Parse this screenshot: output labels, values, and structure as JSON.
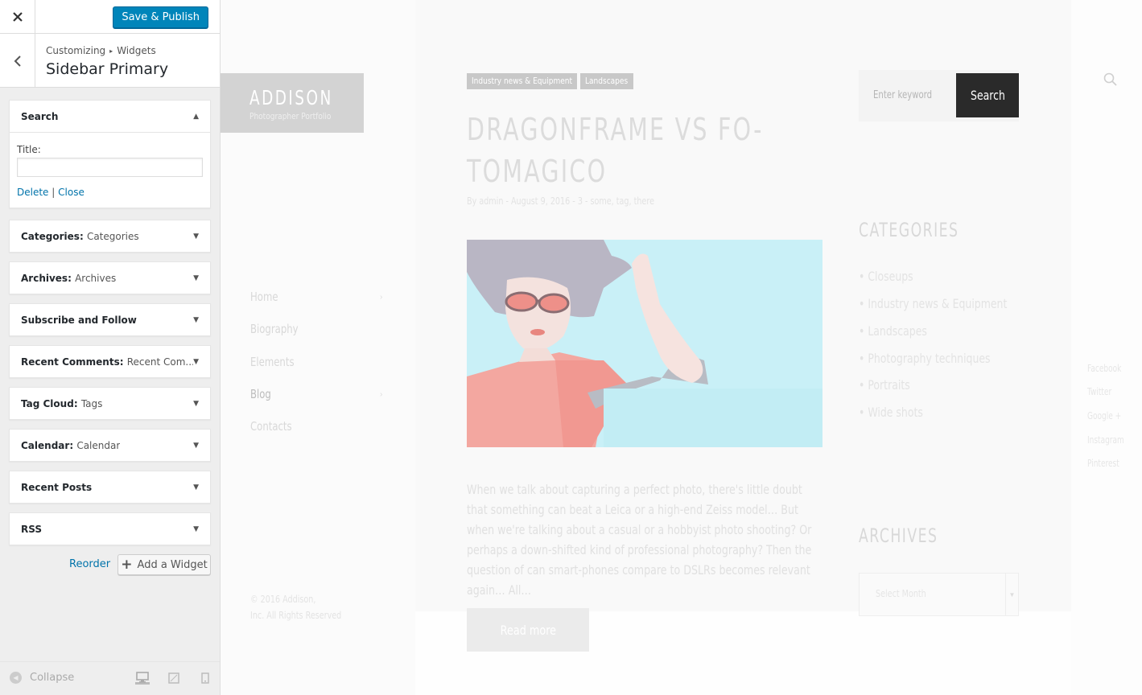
{
  "customizer": {
    "close_icon": "close-icon",
    "publish_label": "Save & Publish",
    "breadcrumb": [
      "Customizing",
      "Widgets"
    ],
    "breadcrumb_sep": "▸",
    "section_title": "Sidebar Primary",
    "widgets": [
      {
        "title": "Search",
        "in": "",
        "expanded": true
      },
      {
        "title": "Categories",
        "in": "Categories"
      },
      {
        "title": "Archives",
        "in": "Archives"
      },
      {
        "title": "Subscribe and Follow",
        "in": ""
      },
      {
        "title": "Recent Comments",
        "in": "Recent Com..."
      },
      {
        "title": "Tag Cloud",
        "in": "Tags"
      },
      {
        "title": "Calendar",
        "in": "Calendar"
      },
      {
        "title": "Recent Posts",
        "in": ""
      },
      {
        "title": "RSS",
        "in": ""
      }
    ],
    "search_widget": {
      "title_label": "Title:",
      "title_value": "",
      "delete_label": "Delete",
      "separator": "|",
      "close_label": "Close"
    },
    "colon": ":",
    "reorder_label": "Reorder",
    "add_widget_label": "Add a Widget",
    "collapse_label": "Collapse",
    "accent_color": "#0085ba",
    "link_color": "#0073aa"
  },
  "preview": {
    "logo_title": "ADDISON",
    "logo_subtitle": "Photographer Portfolio",
    "nav": [
      "Home",
      "Biography",
      "Elements",
      "Blog",
      "Contacts"
    ],
    "nav_active": "Blog",
    "copyright_line1": "© 2016 Addison,",
    "copyright_line2": "Inc. All Rights Reserved",
    "post_tags": [
      "Industry news & Equipment",
      "Landscapes"
    ],
    "post_title_line1": "DRAGONFRAME VS FO-",
    "post_title_line2": "TOMAGICO",
    "post_meta": "By admin - August 9, 2016 - 3 - some, tag, there",
    "post_excerpt": "When we talk about capturing a perfect photo, there's little doubt that something can beat a Leica or a high-end Zeiss model… But when we're talking about a casual or a hobbyist photo shooting? Or perhaps a down-shifted kind of professional photography? Then the question of can smart-phones compare to DSLRs becomes relevant again… All…",
    "read_more": "Read more",
    "search_placeholder": "Enter keyword",
    "search_button": "Search",
    "categories_heading": "CATEGORIES",
    "categories": [
      "Closeups",
      "Industry news & Equipment",
      "Landscapes",
      "Photography techniques",
      "Portraits",
      "Wide shots"
    ],
    "archives_heading": "ARCHIVES",
    "archives_select": "Select Month",
    "social": [
      "Facebook",
      "Twitter",
      "Google +",
      "Instagram",
      "Pinterest"
    ]
  }
}
